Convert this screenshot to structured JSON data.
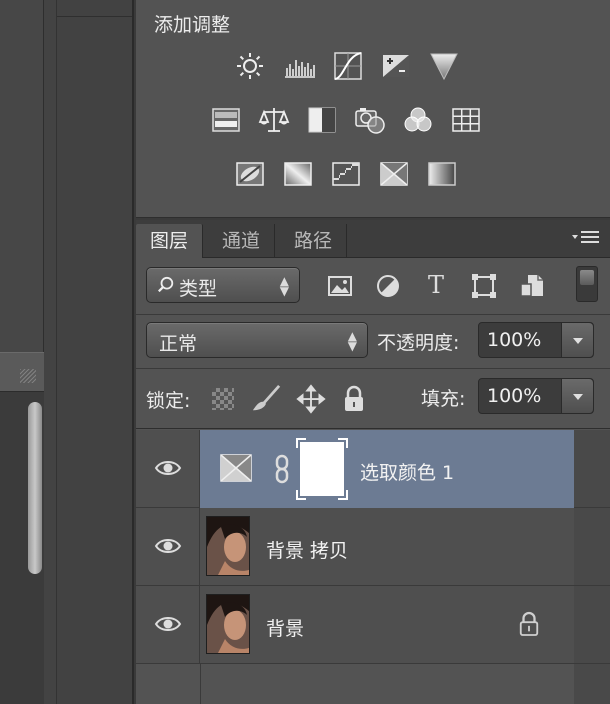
{
  "adjustments": {
    "title": "添加调整",
    "rows": [
      [
        "brightness-contrast-icon",
        "levels-icon",
        "curves-icon",
        "exposure-icon",
        "vibrance-icon"
      ],
      [
        "hue-saturation-icon",
        "color-balance-icon",
        "black-white-icon",
        "photo-filter-icon",
        "channel-mixer-icon",
        "color-lookup-icon"
      ],
      [
        "invert-icon",
        "posterize-icon",
        "threshold-icon",
        "selective-color-icon",
        "gradient-map-icon"
      ]
    ]
  },
  "layers_panel": {
    "tabs": [
      {
        "label": "图层",
        "active": true
      },
      {
        "label": "通道",
        "active": false
      },
      {
        "label": "路径",
        "active": false
      }
    ],
    "menu_icon": "panel-menu-icon",
    "filter": {
      "kind_label": "类型",
      "filter_icons": [
        "image-filter-icon",
        "adjustment-filter-icon",
        "type-filter-icon",
        "shape-filter-icon",
        "smart-object-filter-icon"
      ],
      "toggle_icon": "filter-toggle-icon"
    },
    "blend": {
      "mode": "正常",
      "opacity_label": "不透明度:",
      "opacity_value": "100%"
    },
    "lock": {
      "label": "锁定:",
      "icons": [
        "lock-transparent-icon",
        "lock-pixels-icon",
        "lock-position-icon",
        "lock-all-icon"
      ],
      "fill_label": "填充:",
      "fill_value": "100%"
    },
    "layers": [
      {
        "name": "选取颜色 1",
        "selected": true,
        "type": "adjustment",
        "icon": "selective-color-icon",
        "locked": false
      },
      {
        "name": "背景 拷贝",
        "selected": false,
        "type": "image",
        "locked": false
      },
      {
        "name": "背景",
        "selected": false,
        "type": "image",
        "locked": true
      }
    ]
  },
  "colors": {
    "panel": "#535353",
    "selection": "#6c7b93",
    "dark": "#3a3a3a"
  }
}
